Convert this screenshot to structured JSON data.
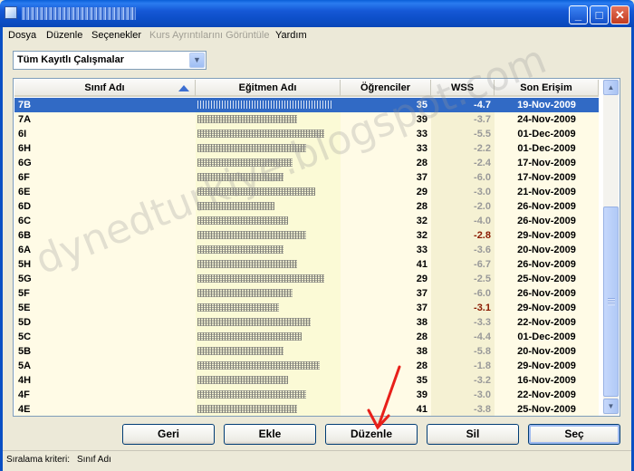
{
  "window": {
    "title_obscured": true
  },
  "menu": [
    "Dosya",
    "Düzenle",
    "Seçenekler",
    "Kurs Ayrıntılarını Görüntüle",
    "Yardım"
  ],
  "menu_disabled_index": 3,
  "filter": {
    "value": "Tüm Kayıtlı Çalışmalar"
  },
  "table": {
    "columns": [
      "Sınıf Adı",
      "Eğitmen Adı",
      "Öğrenciler",
      "WSS",
      "Son Erişim"
    ],
    "rows": [
      {
        "name": "7B",
        "students": "35",
        "wss": "-4.7",
        "last": "19-Nov-2009",
        "selected": true
      },
      {
        "name": "7A",
        "students": "39",
        "wss": "-3.7",
        "last": "24-Nov-2009"
      },
      {
        "name": "6I",
        "students": "33",
        "wss": "-5.5",
        "last": "01-Dec-2009"
      },
      {
        "name": "6H",
        "students": "33",
        "wss": "-2.2",
        "last": "01-Dec-2009"
      },
      {
        "name": "6G",
        "students": "28",
        "wss": "-2.4",
        "last": "17-Nov-2009"
      },
      {
        "name": "6F",
        "students": "37",
        "wss": "-6.0",
        "last": "17-Nov-2009"
      },
      {
        "name": "6E",
        "students": "29",
        "wss": "-3.0",
        "last": "21-Nov-2009"
      },
      {
        "name": "6D",
        "students": "28",
        "wss": "-2.0",
        "last": "26-Nov-2009"
      },
      {
        "name": "6C",
        "students": "32",
        "wss": "-4.0",
        "last": "26-Nov-2009"
      },
      {
        "name": "6B",
        "students": "32",
        "wss": "-2.8",
        "last": "29-Nov-2009",
        "hot": true
      },
      {
        "name": "6A",
        "students": "33",
        "wss": "-3.6",
        "last": "20-Nov-2009"
      },
      {
        "name": "5H",
        "students": "41",
        "wss": "-6.7",
        "last": "26-Nov-2009"
      },
      {
        "name": "5G",
        "students": "29",
        "wss": "-2.5",
        "last": "25-Nov-2009"
      },
      {
        "name": "5F",
        "students": "37",
        "wss": "-6.0",
        "last": "26-Nov-2009"
      },
      {
        "name": "5E",
        "students": "37",
        "wss": "-3.1",
        "last": "29-Nov-2009",
        "hot": true
      },
      {
        "name": "5D",
        "students": "38",
        "wss": "-3.3",
        "last": "22-Nov-2009"
      },
      {
        "name": "5C",
        "students": "28",
        "wss": "-4.4",
        "last": "01-Dec-2009"
      },
      {
        "name": "5B",
        "students": "38",
        "wss": "-5.8",
        "last": "20-Nov-2009"
      },
      {
        "name": "5A",
        "students": "28",
        "wss": "-1.8",
        "last": "29-Nov-2009"
      },
      {
        "name": "4H",
        "students": "35",
        "wss": "-3.2",
        "last": "16-Nov-2009"
      },
      {
        "name": "4F",
        "students": "39",
        "wss": "-3.0",
        "last": "22-Nov-2009"
      },
      {
        "name": "4E",
        "students": "41",
        "wss": "-3.8",
        "last": "25-Nov-2009"
      }
    ]
  },
  "buttons": {
    "back": "Geri",
    "add": "Ekle",
    "edit": "Düzenle",
    "delete": "Sil",
    "select": "Seç"
  },
  "status": {
    "label": "Sıralama kriteri:",
    "value": "Sınıf Adı"
  },
  "watermark": "dynedturkiye.blogspot.com",
  "colors": {
    "selection": "#316ac5",
    "titlebar": "#0a5fd8",
    "wss_hot": "#8a1a00"
  }
}
